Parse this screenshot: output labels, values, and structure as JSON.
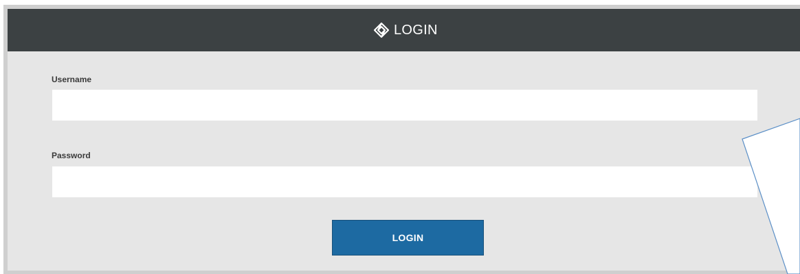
{
  "header": {
    "icon": "diamond-logo-icon",
    "title": "LOGIN"
  },
  "form": {
    "username_label": "Username",
    "username_value": "",
    "username_placeholder": "",
    "password_label": "Password",
    "password_value": "",
    "password_placeholder": "",
    "submit_label": "LOGIN"
  },
  "colors": {
    "header_bg": "#3c4143",
    "panel_bg": "#e6e6e6",
    "button_bg": "#1d6aa2",
    "callout_stroke": "#5b8fc7"
  }
}
